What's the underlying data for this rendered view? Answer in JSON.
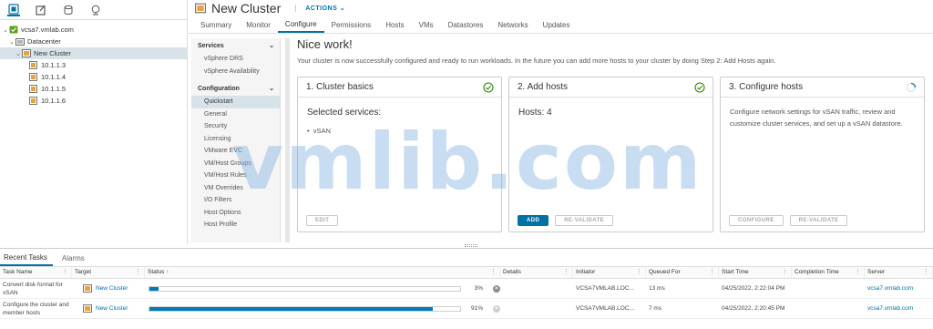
{
  "tree": {
    "vcenter": "vcsa7.vmlab.com",
    "datacenter": "Datacenter",
    "cluster": "New Cluster",
    "hosts": [
      "10.1.1.3",
      "10.1.1.4",
      "10.1.1.5",
      "10.1.1.6"
    ]
  },
  "header": {
    "title": "New Cluster",
    "actions_label": "ACTIONS",
    "tabs": [
      "Summary",
      "Monitor",
      "Configure",
      "Permissions",
      "Hosts",
      "VMs",
      "Datastores",
      "Networks",
      "Updates"
    ]
  },
  "config_nav": {
    "services_heading": "Services",
    "services": [
      "vSphere DRS",
      "vSphere Availability"
    ],
    "configuration_heading": "Configuration",
    "configuration": [
      "Quickstart",
      "General",
      "Security",
      "Licensing",
      "VMware EVC",
      "VM/Host Groups",
      "VM/Host Rules",
      "VM Overrides",
      "I/O Filters",
      "Host Options",
      "Host Profile"
    ]
  },
  "main": {
    "title": "Nice work!",
    "description": "Your cluster is now successfully configured and ready to run workloads. In the future you can add more hosts to your cluster by doing Step 2: Add Hosts again.",
    "cards": [
      {
        "title": "1. Cluster basics",
        "subtitle": "Selected services:",
        "list_item": "vSAN",
        "buttons": [
          "EDIT"
        ]
      },
      {
        "title": "2. Add hosts",
        "subtitle": "Hosts: 4",
        "buttons": [
          "ADD",
          "RE-VALIDATE"
        ]
      },
      {
        "title": "3. Configure hosts",
        "text": "Configure network settings for vSAN traffic, review and customize cluster services, and set up a vSAN datastore.",
        "buttons": [
          "CONFIGURE",
          "RE-VALIDATE"
        ]
      }
    ]
  },
  "watermark": "vmlib.com",
  "tasks": {
    "tabs": [
      "Recent Tasks",
      "Alarms"
    ],
    "columns": [
      "Task Name",
      "Target",
      "Status",
      "Details",
      "Initiator",
      "Queued For",
      "Start Time",
      "Completion Time",
      "Server"
    ],
    "rows": [
      {
        "task": "Convert disk format for vSAN",
        "target": "New Cluster",
        "progress": 3,
        "pct_label": "3%",
        "details": "",
        "initiator": "VCSA7VMLAB.LOC...",
        "queued": "13 ms",
        "start": "04/25/2022, 2:22:04 PM",
        "completion": "",
        "server": "vcsa7.vmlab.com"
      },
      {
        "task": "Configure the cluster and member hosts",
        "target": "New Cluster",
        "progress": 91,
        "pct_label": "91%",
        "details": "",
        "initiator": "VCSA7VMLAB.LOC...",
        "queued": "7 ms",
        "start": "04/25/2022, 2:20:45 PM",
        "completion": "",
        "server": "vcsa7.vmlab.com"
      }
    ]
  },
  "colors": {
    "accent": "#0072a3",
    "selected": "#d8e3e9",
    "success": "#2f8400",
    "progress": "#0079b8"
  }
}
